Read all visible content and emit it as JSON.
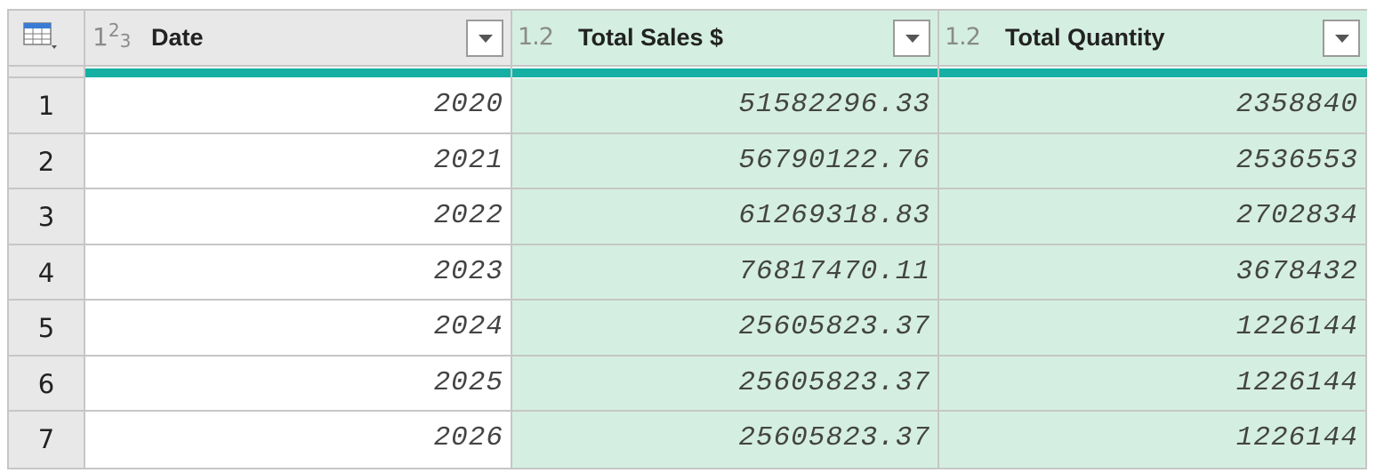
{
  "columns": [
    {
      "type_icon": "123",
      "title": "Date"
    },
    {
      "type_icon": "1.2",
      "title": "Total Sales $"
    },
    {
      "type_icon": "1.2",
      "title": "Total Quantity"
    }
  ],
  "rows": [
    {
      "num": "1",
      "date": "2020",
      "sales": "51582296.33",
      "qty": "2358840"
    },
    {
      "num": "2",
      "date": "2021",
      "sales": "56790122.76",
      "qty": "2536553"
    },
    {
      "num": "3",
      "date": "2022",
      "sales": "61269318.83",
      "qty": "2702834"
    },
    {
      "num": "4",
      "date": "2023",
      "sales": "76817470.11",
      "qty": "3678432"
    },
    {
      "num": "5",
      "date": "2024",
      "sales": "25605823.37",
      "qty": "1226144"
    },
    {
      "num": "6",
      "date": "2025",
      "sales": "25605823.37",
      "qty": "1226144"
    },
    {
      "num": "7",
      "date": "2026",
      "sales": "25605823.37",
      "qty": "1226144"
    }
  ],
  "colors": {
    "selected_column_bg": "#d4efe1",
    "quality_bar": "#15b0a3",
    "header_bg": "#e8e8e8",
    "grid_line": "#c6c6c6"
  },
  "icons": {
    "corner": "table-menu-icon",
    "whole_number": "whole-number-type-icon",
    "decimal": "decimal-type-icon",
    "filter": "dropdown-arrow-icon"
  }
}
